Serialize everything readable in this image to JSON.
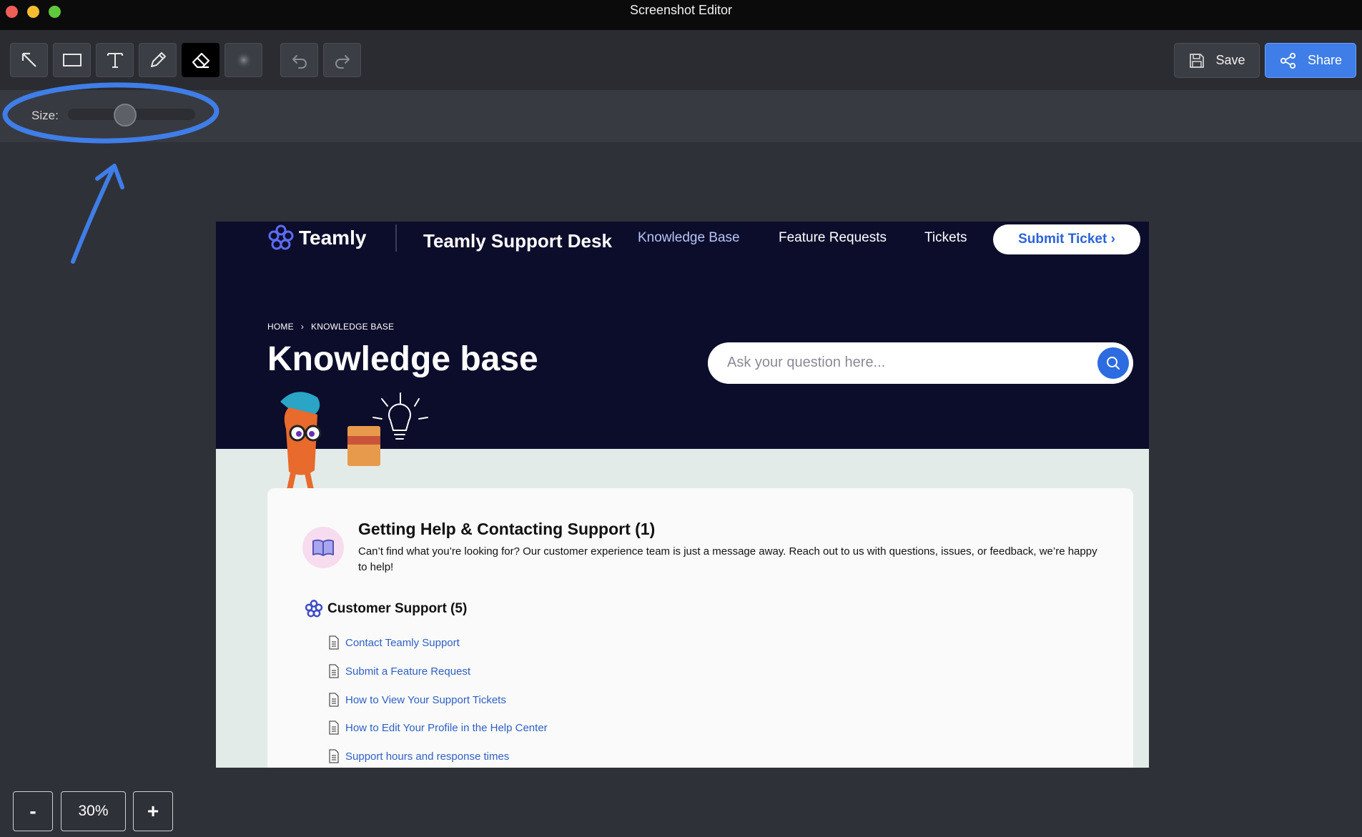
{
  "window": {
    "title": "Screenshot Editor"
  },
  "toolbar": {
    "tools": [
      {
        "name": "arrow",
        "icon": "arrow-icon"
      },
      {
        "name": "rectangle",
        "icon": "rectangle-icon"
      },
      {
        "name": "text",
        "icon": "text-icon"
      },
      {
        "name": "pen",
        "icon": "pencil-icon"
      },
      {
        "name": "eraser",
        "icon": "eraser-icon",
        "active": true
      },
      {
        "name": "blur",
        "icon": "blur-icon"
      }
    ],
    "undo_icon": "undo-icon",
    "redo_icon": "redo-icon",
    "save_label": "Save",
    "share_label": "Share"
  },
  "options": {
    "size_label": "Size:",
    "size_value_fraction": 0.4
  },
  "annotation": {
    "color": "#3f7ee8"
  },
  "capture": {
    "logo_text": "Teamly",
    "desk_title": "Teamly Support Desk",
    "nav": {
      "knowledge_base": "Knowledge Base",
      "feature_requests": "Feature Requests",
      "tickets": "Tickets",
      "submit_ticket": "Submit Ticket ›"
    },
    "breadcrumb": {
      "home": "HOME",
      "separator": "›",
      "current": "KNOWLEDGE BASE"
    },
    "page_title": "Knowledge base",
    "search_placeholder": "Ask your question here...",
    "section": {
      "title": "Getting Help & Contacting Support (1)",
      "description": "Can’t find what you’re looking for? Our customer experience team is just a message away. Reach out to us with questions, issues, or feedback, we’re happy to help!"
    },
    "group": {
      "title": "Customer Support (5)",
      "articles": [
        "Contact Teamly Support",
        "Submit a Feature Request",
        "How to View Your Support Tickets",
        "How to Edit Your Profile in the Help Center",
        "Support hours and response times"
      ]
    },
    "colors": {
      "hero_bg": "#0c0c2b",
      "brand_blue": "#2d6be0",
      "link": "#2f5fc4"
    }
  },
  "zoom": {
    "minus": "-",
    "value": "30%",
    "plus": "+"
  }
}
